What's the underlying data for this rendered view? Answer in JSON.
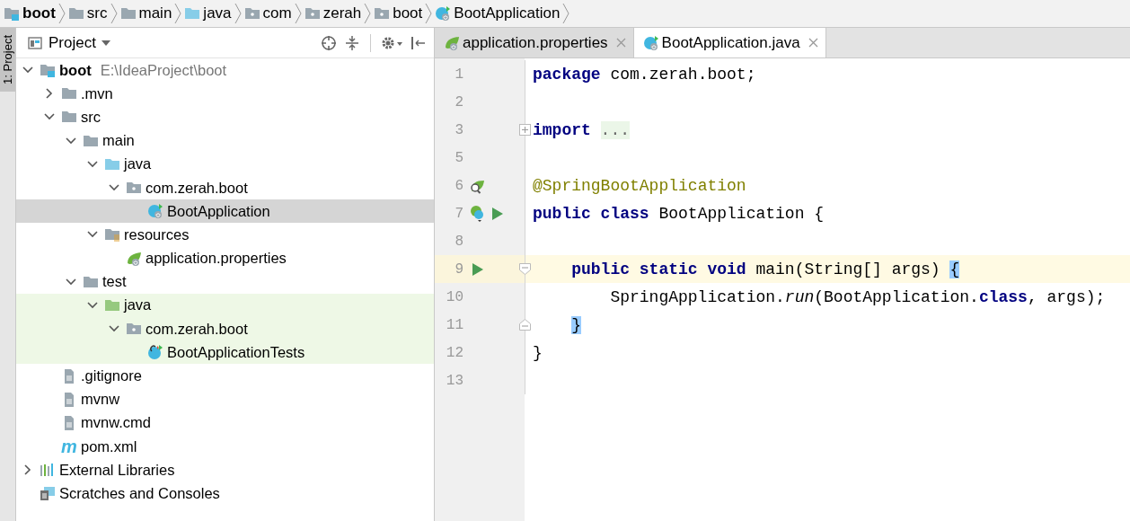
{
  "breadcrumbs": [
    {
      "label": "boot",
      "kind": "module",
      "bold": true
    },
    {
      "label": "src",
      "kind": "folder"
    },
    {
      "label": "main",
      "kind": "folder"
    },
    {
      "label": "java",
      "kind": "source-folder"
    },
    {
      "label": "com",
      "kind": "package"
    },
    {
      "label": "zerah",
      "kind": "package"
    },
    {
      "label": "boot",
      "kind": "package"
    },
    {
      "label": "BootApplication",
      "kind": "spring-class"
    }
  ],
  "side_stripe": {
    "label": "1: Project"
  },
  "project_panel": {
    "title": "Project",
    "tree": [
      {
        "label": "boot",
        "path": "E:\\IdeaProject\\boot",
        "kind": "module",
        "expanded": true,
        "children": [
          {
            "label": ".mvn",
            "kind": "folder",
            "expanded": false
          },
          {
            "label": "src",
            "kind": "folder",
            "expanded": true,
            "children": [
              {
                "label": "main",
                "kind": "folder",
                "expanded": true,
                "children": [
                  {
                    "label": "java",
                    "kind": "source-folder",
                    "expanded": true,
                    "children": [
                      {
                        "label": "com.zerah.boot",
                        "kind": "package",
                        "expanded": true,
                        "children": [
                          {
                            "label": "BootApplication",
                            "kind": "spring-class",
                            "selected": true
                          }
                        ]
                      }
                    ]
                  },
                  {
                    "label": "resources",
                    "kind": "resources",
                    "expanded": true,
                    "children": [
                      {
                        "label": "application.properties",
                        "kind": "spring-file",
                        "selected": false
                      }
                    ]
                  }
                ]
              },
              {
                "label": "test",
                "kind": "folder",
                "expanded": true,
                "children": [
                  {
                    "label": "java",
                    "kind": "test-folder",
                    "tinted": true,
                    "expanded": true,
                    "children": [
                      {
                        "label": "com.zerah.boot",
                        "kind": "package",
                        "tinted": true,
                        "expanded": true,
                        "children": [
                          {
                            "label": "BootApplicationTests",
                            "kind": "test-class",
                            "tinted": true,
                            "selected": false
                          }
                        ]
                      }
                    ]
                  }
                ]
              }
            ]
          },
          {
            "label": ".gitignore",
            "kind": "text-file",
            "selected": false
          },
          {
            "label": "mvnw",
            "kind": "text-file",
            "selected": false
          },
          {
            "label": "mvnw.cmd",
            "kind": "text-file",
            "selected": false
          },
          {
            "label": "pom.xml",
            "kind": "maven",
            "icon_text": "m",
            "selected": false
          }
        ]
      },
      {
        "label": "External Libraries",
        "kind": "libraries",
        "expanded": false
      },
      {
        "label": "Scratches and Consoles",
        "kind": "scratches",
        "selected": false
      }
    ]
  },
  "editor": {
    "tabs": [
      {
        "label": "application.properties",
        "kind": "spring-file",
        "selected": false
      },
      {
        "label": "BootApplication.java",
        "kind": "spring-class",
        "selected": true
      }
    ],
    "lines": [
      {
        "number": "1",
        "segments": [
          {
            "kind": "keyword",
            "text": "package"
          },
          {
            "kind": "plain",
            "text": " com.zerah.boot;"
          }
        ]
      },
      {
        "number": "2"
      },
      {
        "number": "3",
        "fold": {
          "kind": "collapsed"
        },
        "segments": [
          {
            "kind": "keyword",
            "text": "import"
          },
          {
            "kind": "folded",
            "text": "..."
          }
        ]
      },
      {
        "number": "5"
      },
      {
        "number": "6",
        "gutter": [
          {
            "kind": "bean"
          }
        ],
        "segments": [
          {
            "kind": "annotation",
            "text": "@SpringBootApplication"
          }
        ]
      },
      {
        "number": "7",
        "gutter": [
          {
            "kind": "class"
          },
          {
            "kind": "run"
          }
        ],
        "segments": [
          {
            "kind": "keyword",
            "text": "public class"
          },
          {
            "kind": "plain",
            "text": " BootApplication {"
          }
        ]
      },
      {
        "number": "8"
      },
      {
        "number": "9",
        "current": true,
        "kind": "member",
        "gutter": [
          {
            "kind": "run"
          }
        ],
        "fold": {
          "kind": "start"
        },
        "segments": [
          {
            "kind": "keyword",
            "text": "public static void"
          },
          {
            "kind": "plain",
            "text": " main(String[] args) "
          },
          {
            "kind": "brace-match",
            "text": "{"
          }
        ]
      },
      {
        "number": "10",
        "kind": "statement",
        "segments": [
          {
            "kind": "plain",
            "text": "SpringApplication."
          },
          {
            "kind": "italic",
            "text": "run"
          },
          {
            "kind": "plain",
            "text": "(BootApplication."
          },
          {
            "kind": "keyword",
            "text": "class"
          },
          {
            "kind": "plain",
            "text": ", args);"
          }
        ]
      },
      {
        "number": "11",
        "kind": "member",
        "fold": {
          "kind": "end"
        },
        "segments": [
          {
            "kind": "brace-match",
            "text": "}"
          }
        ]
      },
      {
        "number": "12",
        "segments": [
          {
            "kind": "plain",
            "text": "}"
          }
        ]
      },
      {
        "number": "13"
      }
    ]
  }
}
